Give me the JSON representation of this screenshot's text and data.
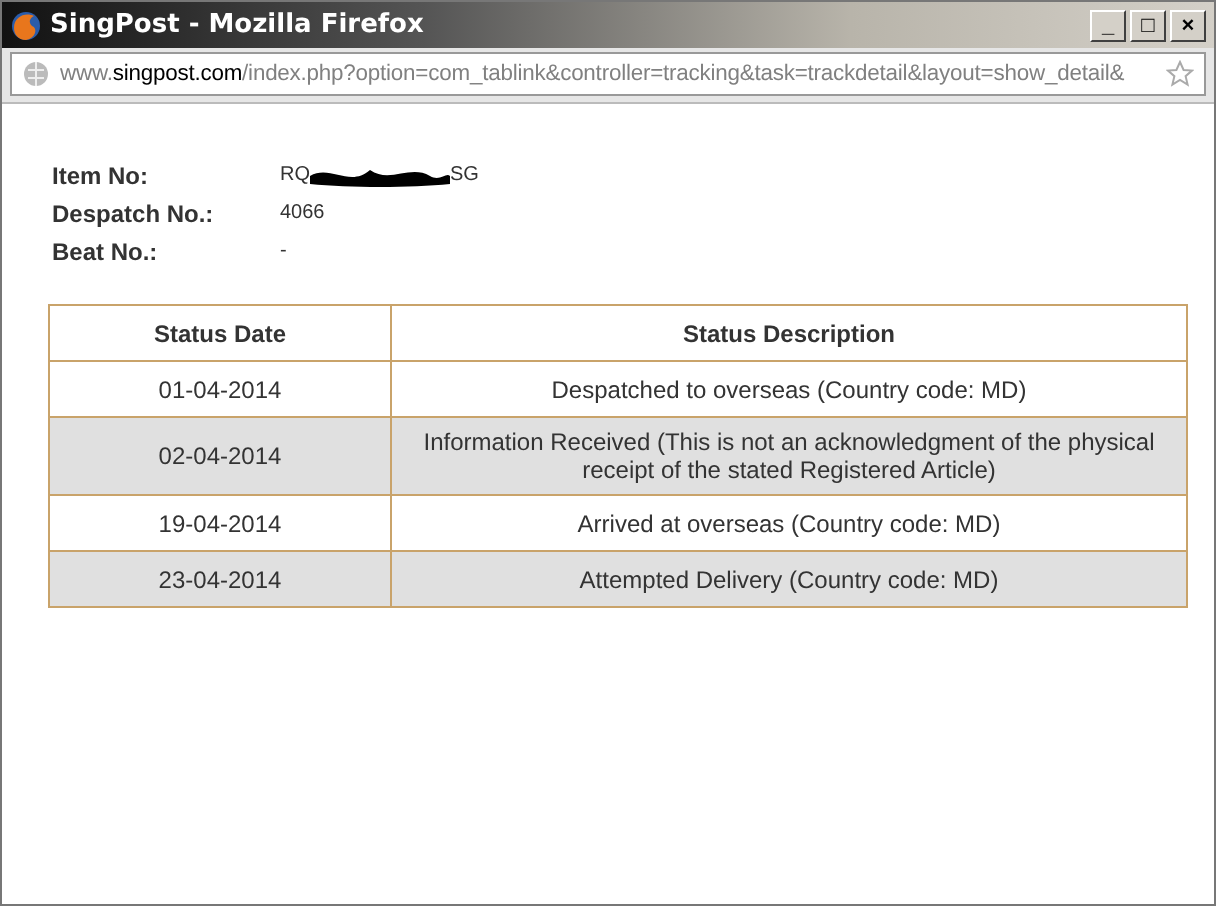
{
  "window": {
    "title": "SingPost - Mozilla Firefox",
    "controls": [
      "_",
      "□",
      "×"
    ]
  },
  "address_bar": {
    "prefix": "www.",
    "domain": "singpost.com",
    "path": "/index.php?option=com_tablink&controller=tracking&task=trackdetail&layout=show_detail&"
  },
  "details": [
    {
      "label": "Item No:",
      "value_start": "RQ",
      "value_end": "SG",
      "redacted": true
    },
    {
      "label": "Despatch No.:",
      "value_start": "4066"
    },
    {
      "label": "Beat No.:",
      "value_start": "-"
    }
  ],
  "table": {
    "columns": [
      "Status Date",
      "Status Description"
    ],
    "rows": [
      {
        "date": "01-04-2014",
        "description": "Despatched to overseas (Country code: MD)"
      },
      {
        "date": "02-04-2014",
        "description": "Information Received (This is not an acknowledgment of the physical receipt of the stated Registered Article)"
      },
      {
        "date": "19-04-2014",
        "description": "Arrived at overseas (Country code: MD)"
      },
      {
        "date": "23-04-2014",
        "description": "Attempted Delivery (Country code: MD)"
      }
    ]
  }
}
